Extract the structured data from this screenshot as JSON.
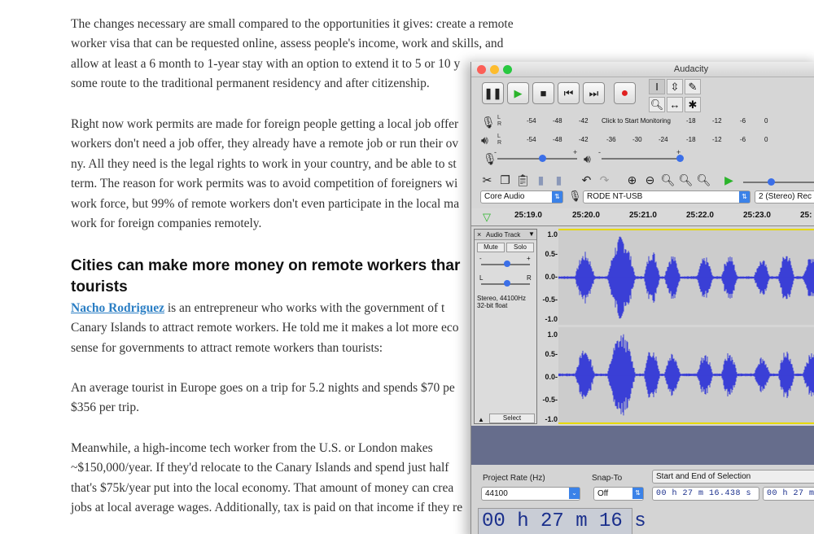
{
  "article": {
    "p1": "The changes necessary are small compared to the opportunities it gives: create a remote worker visa that can be requested online, assess people's income, work and skills, and allow at least a 6 month to 1-year stay with an option to extend it to 5 or 10 y... and some route to the traditional permanent residency and after citizenship.",
    "p1_lines": [
      "The changes necessary are small compared to the opportunities it gives: create a remote",
      "worker visa that can be requested online, assess people's income, work and skills, and",
      "allow at least a 6 month to 1-year stay with an option to extend it to 5 or 10 y",
      "some route to the traditional permanent residency and after citizenship."
    ],
    "p2_lines": [
      "Right now work permits are made for foreign people getting a local job offer",
      "workers don't need a job offer, they already have a remote job or run their ov",
      "ny. All they need is the legal rights to work in your country, and be able to st",
      "term. The reason for work permits was to avoid competition of foreigners wi",
      "work force, but 99% of remote workers don't even participate in the local ma",
      "work for foreign companies remotely."
    ],
    "heading_lines": [
      "Cities can make more money on remote workers thar",
      "tourists"
    ],
    "author": "Nacho Rodriguez",
    "p3_line1_rest": " is an entrepreneur who works with the government of t",
    "p3_lines": [
      "Canary Islands to attract remote workers. He told me it makes a lot more eco",
      "sense for governments to attract remote workers than tourists:"
    ],
    "p4_lines": [
      "An average tourist in Europe goes on a trip for 5.2 nights and spends $70 pe",
      "$356 per trip."
    ],
    "p5_lines": [
      "Meanwhile, a high-income tech worker from the U.S. or London makes",
      "~$150,000/year. If they'd relocate to the Canary Islands and spend just half",
      "that's $75k/year put into the local economy. That amount of money can crea",
      "jobs at local average wages. Additionally, tax is paid on that income if they re"
    ]
  },
  "audacity": {
    "title": "Audacity",
    "meter_rec_ticks": [
      "-54",
      "-48",
      "-42",
      "-18",
      "-12",
      "-6",
      "0"
    ],
    "meter_rec_prompt": "Click to Start Monitoring",
    "meter_play_ticks": [
      "-54",
      "-48",
      "-42",
      "-36",
      "-30",
      "-24",
      "-18",
      "-12",
      "-6",
      "0"
    ],
    "meter_lr": [
      "L",
      "R",
      "L",
      "R"
    ],
    "slider_minus": "-",
    "slider_plus": "+",
    "host": "Core Audio",
    "rec_device": "RODE NT-USB",
    "channels": "2 (Stereo) Rec",
    "timeline": [
      "25:19.0",
      "25:20.0",
      "25:21.0",
      "25:22.0",
      "25:23.0",
      "25:"
    ],
    "track": {
      "name": "Audio Track",
      "mute": "Mute",
      "solo": "Solo",
      "gain_minus": "-",
      "gain_plus": "+",
      "pan_l": "L",
      "pan_r": "R",
      "info1": "Stereo, 44100Hz",
      "info2": "32-bit float",
      "select": "Select",
      "scale": [
        "1.0",
        "0.5-",
        "0.0-",
        "-0.5-",
        "-1.0",
        "1.0",
        "0.5-",
        "0.0-",
        "-0.5-",
        "-1.0"
      ]
    },
    "project_rate_label": "Project Rate (Hz)",
    "project_rate": "44100",
    "snap_label": "Snap-To",
    "snap": "Off",
    "selection_label": "Start and End of Selection",
    "sel_start": "00 h 27 m 16.438 s",
    "sel_end": "00 h 27 m",
    "big_time": "00 h 27 m 16 s"
  },
  "colors": {
    "waveform": "#3a3fd6",
    "link": "#2a7ec4",
    "track_panel": "#dcdcdc"
  }
}
